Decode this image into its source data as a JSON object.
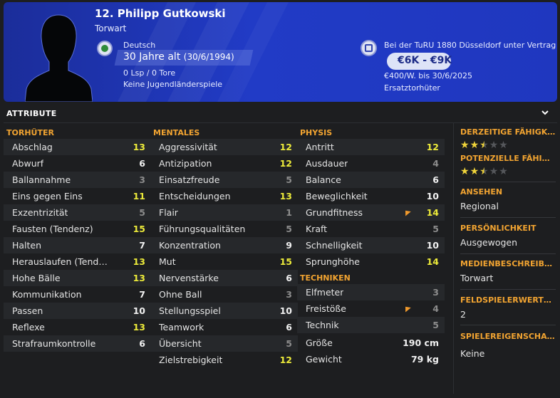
{
  "header": {
    "name": "12. Philipp Gutkowski",
    "position": "Torwart",
    "nationality": "Deutsch",
    "age": "30 Jahre alt",
    "dob": "(30/6/1994)",
    "apps": "0 Lsp / 0 Tore",
    "youth": "Keine Jugendländerspiele",
    "contract": "Bei der TuRU 1880 Düsseldorf unter Vertrag",
    "value": "€6K - €9K",
    "wage": "€400/W. bis 30/6/2025",
    "role": "Ersatztorhüter"
  },
  "attributes": {
    "title": "ATTRIBUTE",
    "goalkeeping": {
      "title": "TORHÜTER",
      "rows": [
        {
          "label": "Abschlag",
          "value": "13",
          "level": "hi"
        },
        {
          "label": "Abwurf",
          "value": "6",
          "level": "mid"
        },
        {
          "label": "Ballannahme",
          "value": "3",
          "level": "lo"
        },
        {
          "label": "Eins gegen Eins",
          "value": "11",
          "level": "hi"
        },
        {
          "label": "Exzentrizität",
          "value": "5",
          "level": "lo"
        },
        {
          "label": "Fausten (Tendenz)",
          "value": "15",
          "level": "hi"
        },
        {
          "label": "Halten",
          "value": "7",
          "level": "mid"
        },
        {
          "label": "Herauslaufen (Tende…",
          "value": "13",
          "level": "hi"
        },
        {
          "label": "Hohe Bälle",
          "value": "13",
          "level": "hi"
        },
        {
          "label": "Kommunikation",
          "value": "7",
          "level": "mid"
        },
        {
          "label": "Passen",
          "value": "10",
          "level": "mid"
        },
        {
          "label": "Reflexe",
          "value": "13",
          "level": "hi"
        },
        {
          "label": "Strafraumkontrolle",
          "value": "6",
          "level": "mid"
        }
      ]
    },
    "mental": {
      "title": "MENTALES",
      "rows": [
        {
          "label": "Aggressivität",
          "value": "12",
          "level": "hi"
        },
        {
          "label": "Antizipation",
          "value": "12",
          "level": "hi"
        },
        {
          "label": "Einsatzfreude",
          "value": "5",
          "level": "lo"
        },
        {
          "label": "Entscheidungen",
          "value": "13",
          "level": "hi"
        },
        {
          "label": "Flair",
          "value": "1",
          "level": "lo"
        },
        {
          "label": "Führungsqualitäten",
          "value": "5",
          "level": "lo"
        },
        {
          "label": "Konzentration",
          "value": "9",
          "level": "mid"
        },
        {
          "label": "Mut",
          "value": "15",
          "level": "hi"
        },
        {
          "label": "Nervenstärke",
          "value": "6",
          "level": "mid"
        },
        {
          "label": "Ohne Ball",
          "value": "3",
          "level": "lo"
        },
        {
          "label": "Stellungsspiel",
          "value": "10",
          "level": "mid"
        },
        {
          "label": "Teamwork",
          "value": "6",
          "level": "mid"
        },
        {
          "label": "Übersicht",
          "value": "5",
          "level": "lo"
        },
        {
          "label": "Zielstrebigkeit",
          "value": "12",
          "level": "hi"
        }
      ]
    },
    "physical": {
      "title": "PHYSIS",
      "rows": [
        {
          "label": "Antritt",
          "value": "12",
          "level": "hi"
        },
        {
          "label": "Ausdauer",
          "value": "4",
          "level": "lo"
        },
        {
          "label": "Balance",
          "value": "6",
          "level": "mid"
        },
        {
          "label": "Beweglichkeit",
          "value": "10",
          "level": "mid"
        },
        {
          "label": "Grundfitness",
          "value": "14",
          "level": "hi",
          "trend": "up"
        },
        {
          "label": "Kraft",
          "value": "5",
          "level": "lo"
        },
        {
          "label": "Schnelligkeit",
          "value": "10",
          "level": "mid"
        },
        {
          "label": "Sprunghöhe",
          "value": "14",
          "level": "hi"
        }
      ]
    },
    "technical": {
      "title": "TECHNIKEN",
      "rows": [
        {
          "label": "Elfmeter",
          "value": "3",
          "level": "lo"
        },
        {
          "label": "Freistöße",
          "value": "4",
          "level": "lo",
          "trend": "up"
        },
        {
          "label": "Technik",
          "value": "5",
          "level": "lo"
        }
      ]
    },
    "body": {
      "rows": [
        {
          "label": "Größe",
          "value": "190 cm"
        },
        {
          "label": "Gewicht",
          "value": "79 kg"
        }
      ]
    }
  },
  "side": {
    "current_ability": {
      "title": "DERZEITIGE FÄHIGKEIT",
      "stars": 2.5,
      "max": 5
    },
    "potential_ability": {
      "title": "POTENZIELLE FÄHIGK…",
      "stars": 2.5,
      "max": 5
    },
    "reputation": {
      "title": "ANSEHEN",
      "value": "Regional"
    },
    "personality": {
      "title": "PERSÖNLICHKEIT",
      "value": "Ausgewogen"
    },
    "media": {
      "title": "MEDIENBESCHREIB…",
      "value": "Torwart"
    },
    "outfield": {
      "title": "FELDSPIELERWERT…",
      "value": "2"
    },
    "traits": {
      "title": "SPIELEREIGENSCHAFT",
      "value": "Keine"
    }
  },
  "colors": {
    "header_bg": "#213bc6",
    "section_title": "#f2a431",
    "value_high": "#ecea3a",
    "star": "#f0d43a",
    "trend_up": "#f19a2c"
  }
}
